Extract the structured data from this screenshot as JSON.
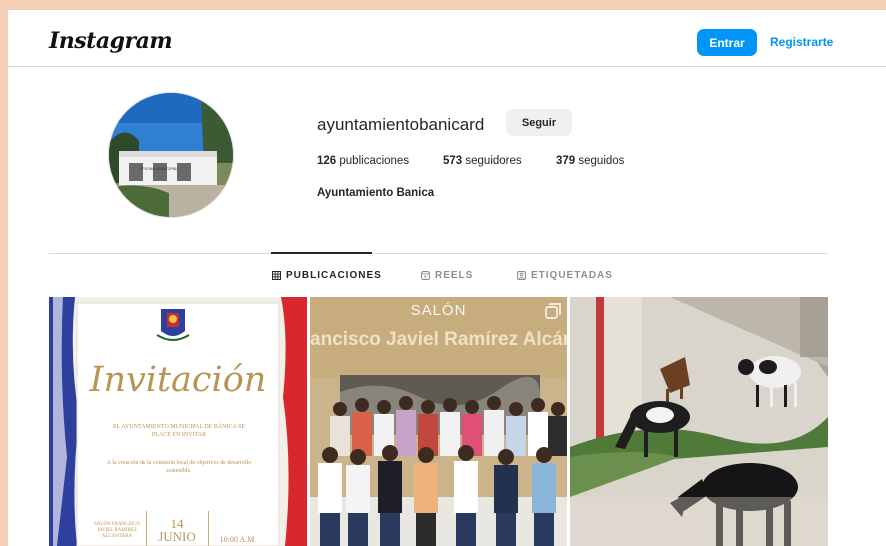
{
  "header": {
    "logo": "Instagram",
    "login_label": "Entrar",
    "signup_label": "Registrarte"
  },
  "profile": {
    "username": "ayuntamientobanicard",
    "follow_label": "Seguir",
    "posts_count": "126",
    "posts_label": "publicaciones",
    "followers_count": "573",
    "followers_label": "seguidores",
    "following_count": "379",
    "following_label": "seguidos",
    "full_name": "Ayuntamiento Banica",
    "avatar_sign": "OFICINA MUNICIPAL"
  },
  "tabs": [
    {
      "label": "PUBLICACIONES",
      "icon": "grid-icon",
      "active": true
    },
    {
      "label": "REELS",
      "icon": "reels-icon",
      "active": false
    },
    {
      "label": "ETIQUETADAS",
      "icon": "tagged-icon",
      "active": false
    }
  ],
  "posts": {
    "invite": {
      "title": "Invitación",
      "line1": "EL AYUNTAMIENTO MUNICIPAL DE BÁNICA SE PLACE EN INVITAR",
      "line2": "A la creación de la comisión local de objetivos de desarrollo sostenible.",
      "venue": "SALÓN FRANCISCO JAVIEL RAMIREZ ALCÁNTARA",
      "day": "14",
      "month": "JUNIO",
      "time": "10:00 A.M"
    },
    "group": {
      "wall_top": "SALÓN",
      "wall_name": "ancisco Javiel Ramírez Alcántara"
    }
  },
  "colors": {
    "accent": "#0095f6",
    "page_bg": "#f5cfb6"
  }
}
